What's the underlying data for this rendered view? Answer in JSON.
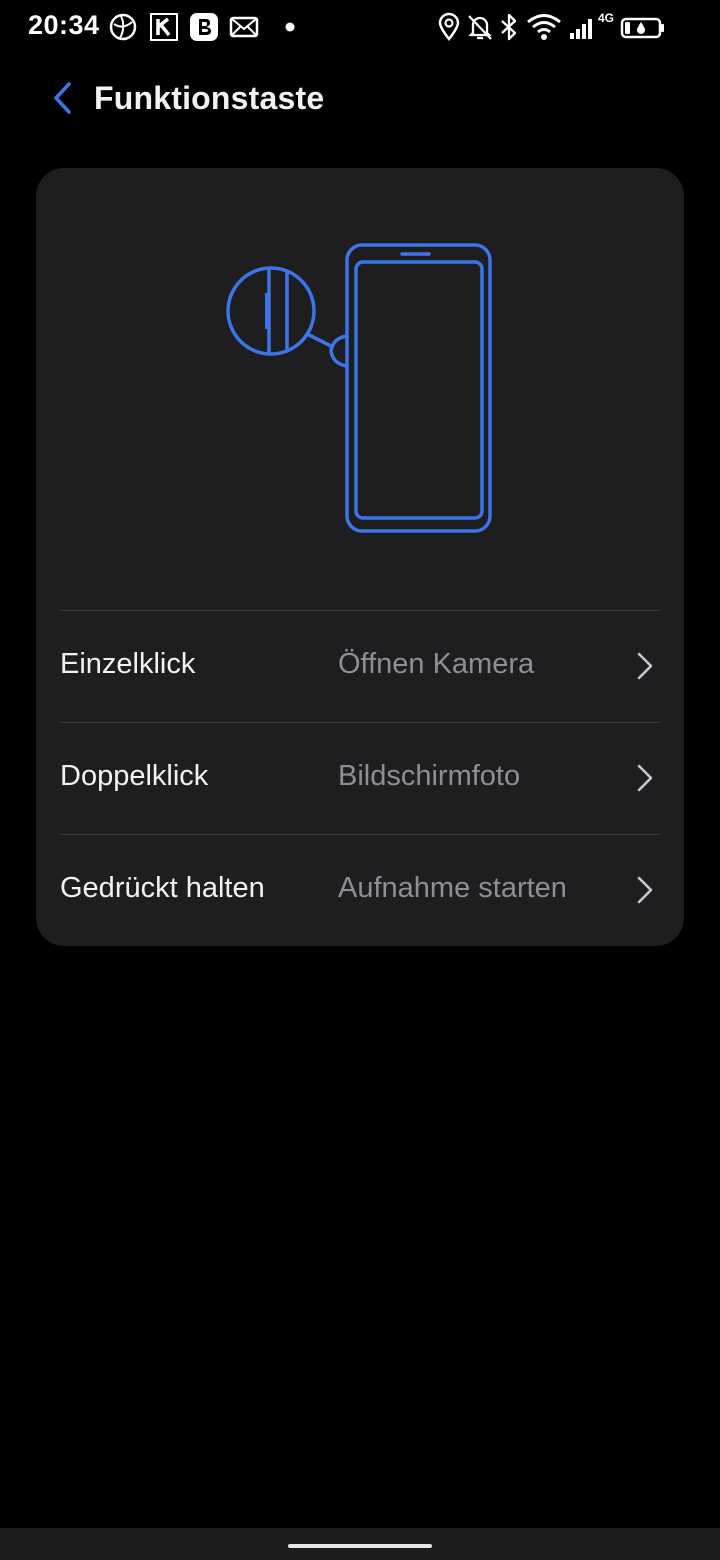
{
  "status_bar": {
    "time": "20:34",
    "network_label": "4G",
    "icons": [
      "globe-icon",
      "k-app-icon",
      "b-app-icon",
      "mail-icon",
      "dot-icon",
      "location-icon",
      "bell-muted-icon",
      "bluetooth-icon",
      "wifi-icon",
      "signal-icon",
      "battery-icon"
    ]
  },
  "header": {
    "title": "Funktionstaste",
    "back_icon": "chevron-left-icon"
  },
  "illustration": {
    "icon": "phone-side-button-icon",
    "accent_color": "#3d74e8"
  },
  "settings": [
    {
      "label": "Einzelklick",
      "value": "Öffnen Kamera"
    },
    {
      "label": "Doppelklick",
      "value": "Bildschirmfoto"
    },
    {
      "label": "Gedrückt halten",
      "value": "Aufnahme starten"
    }
  ],
  "colors": {
    "background": "#000000",
    "card": "#1e1e20",
    "accent": "#3d74e8",
    "text_primary": "#f2f2f2",
    "text_secondary": "#8e8e93"
  }
}
